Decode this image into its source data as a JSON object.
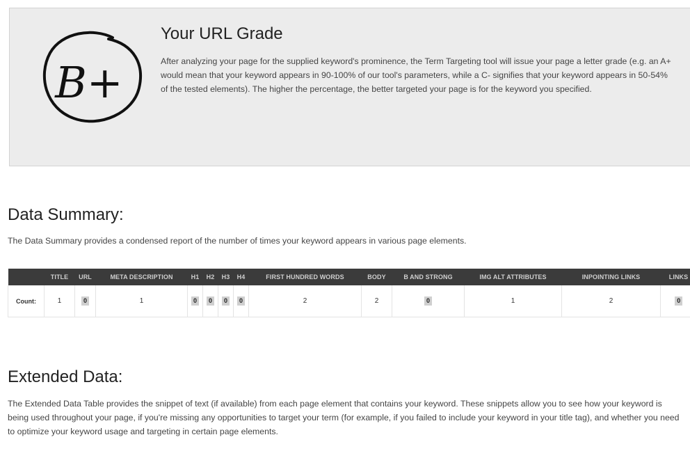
{
  "grade": {
    "title": "Your URL Grade",
    "badge": "B+",
    "description": "After analyzing your page for the supplied keyword's prominence, the Term Targeting tool will issue your page a letter grade (e.g. an A+ would mean that your keyword appears in 90-100% of our tool's parameters, while a C- signifies that your keyword appears in 50-54% of the tested elements). The higher the percentage, the better targeted your page is for the keyword you specified."
  },
  "data_summary": {
    "title": "Data Summary:",
    "description": "The Data Summary provides a condensed report of the number of times your keyword appears in various page elements.",
    "columns": [
      "",
      "TITLE",
      "URL",
      "META DESCRIPTION",
      "H1",
      "H2",
      "H3",
      "H4",
      "FIRST HUNDRED WORDS",
      "BODY",
      "B AND STRONG",
      "IMG ALT ATTRIBUTES",
      "INPOINTING LINKS",
      "LINKS"
    ],
    "row_label": "Count:",
    "counts": [
      "1",
      "0",
      "1",
      "0",
      "0",
      "0",
      "0",
      "2",
      "2",
      "0",
      "1",
      "2",
      "0"
    ]
  },
  "extended_data": {
    "title": "Extended Data:",
    "description": "The Extended Data Table provides the snippet of text (if available) from each page element that contains your keyword. These snippets allow you to see how your keyword is being used throughout your page, if you're missing any opportunities to target your term (for example, if you failed to include your keyword in your title tag), and whether you need to optimize your keyword usage and targeting in certain page elements."
  }
}
